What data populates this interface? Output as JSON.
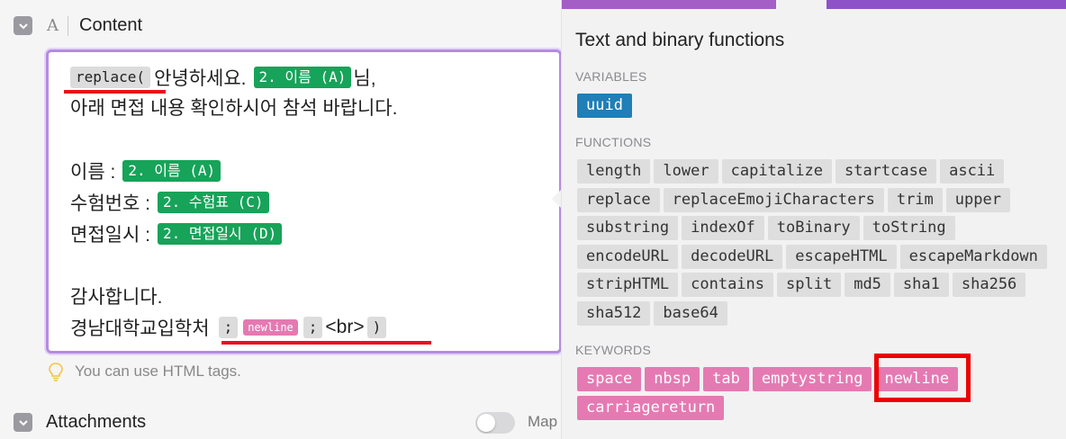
{
  "field": {
    "title": "Content",
    "type_icon": "A",
    "hint": "You can use HTML tags."
  },
  "editor": {
    "line1": {
      "tok_replace": "replace(",
      "text1": "안녕하세요.",
      "tok_name": "2. 이름 (A)",
      "text2": "님,"
    },
    "line2": "아래 면접 내용 확인하시어 참석 바랍니다.",
    "line3": {
      "label": "이름 :",
      "tok": "2. 이름 (A)"
    },
    "line4": {
      "label": "수험번호 :",
      "tok": "2. 수험표 (C)"
    },
    "line5": {
      "label": "면접일시 :",
      "tok": "2. 면접일시 (D)"
    },
    "line6": "감사합니다.",
    "line7": {
      "label": "경남대학교입학처",
      "tok_semi1": ";",
      "tok_newline": "newline",
      "tok_semi2": ";",
      "text_br": "<br>",
      "tok_close": ")"
    }
  },
  "attachments": {
    "label": "Attachments",
    "toggle_on": false,
    "map_label": "Map"
  },
  "panel": {
    "title": "Text and binary functions",
    "variables_label": "VARIABLES",
    "variables": [
      "uuid"
    ],
    "functions_label": "FUNCTIONS",
    "functions": [
      "length",
      "lower",
      "capitalize",
      "startcase",
      "ascii",
      "replace",
      "replaceEmojiCharacters",
      "trim",
      "upper",
      "substring",
      "indexOf",
      "toBinary",
      "toString",
      "encodeURL",
      "decodeURL",
      "escapeHTML",
      "escapeMarkdown",
      "stripHTML",
      "contains",
      "split",
      "md5",
      "sha1",
      "sha256",
      "sha512",
      "base64"
    ],
    "keywords_label": "KEYWORDS",
    "keywords": [
      "space",
      "nbsp",
      "tab",
      "emptystring",
      "newline",
      "carriagereturn"
    ],
    "highlighted_keyword": "newline"
  },
  "colors": {
    "accent_purple": "#a45fc6",
    "token_green": "#17a359",
    "keyword_pink": "#e57ab3",
    "variable_blue": "#1f7fb6",
    "highlight_red": "#ec0000"
  }
}
